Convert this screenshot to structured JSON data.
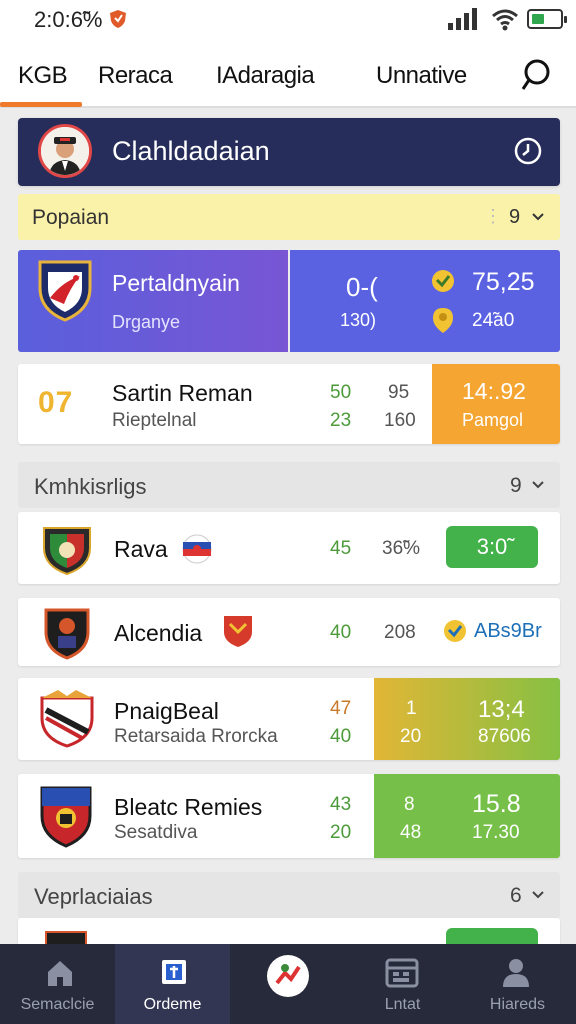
{
  "status_bar": {
    "time": "2:0:6̃%",
    "icons": [
      "shield-icon",
      "signal-icon",
      "wifi-icon",
      "battery-icon"
    ]
  },
  "top_nav": {
    "tabs": [
      {
        "label": "KGB",
        "active": true
      },
      {
        "label": "Reraca"
      },
      {
        "label": "IAdaragia"
      },
      {
        "label": "Unnative"
      }
    ],
    "search_icon": "search-icon"
  },
  "league": {
    "title": "Clahldadaian",
    "icon": "clock-icon"
  },
  "filter": {
    "label": "Popaian",
    "count": "9"
  },
  "featured_match": {
    "title": "Pertaldnyain",
    "subtitle": "Drganye",
    "score_top": "0-(",
    "score_bottom": "130)",
    "value_top": "75,25",
    "value_bottom": "24̃a0"
  },
  "highlight_row": {
    "code": "07",
    "name": "Sartin Reman",
    "subtitle": "Rieptelnal",
    "stats": [
      "50",
      "23",
      "95",
      "160"
    ],
    "panel_top": "14:.92",
    "panel_bottom": "Pamgol"
  },
  "section_1": {
    "label": "Kmhkisrligs",
    "count": "9"
  },
  "matches": [
    {
      "name": "Rava",
      "stat_a": "45",
      "stat_b": "36̃%",
      "badge": "3:0̃"
    },
    {
      "name": "Alcendia",
      "stat_a": "40",
      "stat_b": "208",
      "badge": "ABs9Br"
    },
    {
      "name": "PnaigBeal",
      "subtitle": "Retarsaida Rrorcka",
      "stat_a": "47",
      "stat_a2": "40",
      "stat_b": "1",
      "stat_b2": "20",
      "value_top": "13;4",
      "value_bottom": "87606"
    },
    {
      "name": "Bleatc Remies",
      "subtitle": "Sesatdiva",
      "stat_a": "43",
      "stat_a2": "20",
      "stat_b": "8",
      "stat_b2": "48",
      "value_top": "15.8",
      "value_bottom": "17.30"
    }
  ],
  "section_2": {
    "label": "Veprlaciaias",
    "count": "6"
  },
  "bottom_nav": [
    {
      "label": "Semaclcie",
      "icon": "home-icon"
    },
    {
      "label": "Ordeme",
      "icon": "shirt-icon",
      "active": true
    },
    {
      "label": "",
      "icon": "stats-icon"
    },
    {
      "label": "Lntat",
      "icon": "calendar-icon"
    },
    {
      "label": "Hiareds",
      "icon": "profile-icon"
    }
  ]
}
